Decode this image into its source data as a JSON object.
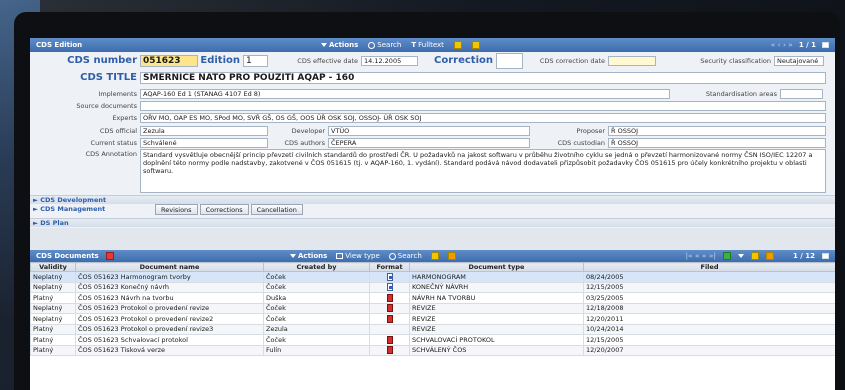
{
  "window": {
    "title": "CDS Edition",
    "actions": "Actions",
    "search": "Search",
    "fulltext": "Fulltext",
    "pager": "1 / 1"
  },
  "form": {
    "cds_number_label": "CDS number",
    "cds_number": "051623",
    "edition_label": "Edition",
    "edition": "1",
    "effective_label": "CDS effective date",
    "effective": "14.12.2005",
    "correction_label": "Correction",
    "correction": "",
    "correction_date_label": "CDS correction date",
    "correction_date": "",
    "security_label": "Security classification",
    "security": "Neutajované",
    "title_label": "CDS TITLE",
    "title": "SMĚRNICE NATO PRO POUŽITÍ AQAP - 160",
    "implements_label": "Implements",
    "implements": "AQAP-160 Ed 1 (STANAG 4107 Ed 8)",
    "std_areas_label": "Standardisation areas",
    "std_areas": "",
    "source_label": "Source documents",
    "source": "",
    "experts_label": "Experts",
    "experts": "OŘV MO, OAP ES MO, SPod MO, SVŘ GŠ, OS GŠ, OOS ÚŘ OSK SOJ, OSSOJ- ÚŘ OSK SOJ",
    "official_label": "CDS official",
    "official": "Zezula",
    "developer_label": "Developer",
    "developer": "VTÚO",
    "proposer_label": "Proposer",
    "proposer": "Ř OSSOJ",
    "status_label": "Current status",
    "status": "Schválené",
    "authors_label": "CDS authors",
    "authors": "ČEPERA",
    "custodian_label": "CDS custodian",
    "custodian": "Ř OSSOJ",
    "annotation_label": "CDS Annotation",
    "annotation": "Standard vysvětluje obecnější princip převzetí civilních standardů do prostředí ČR. U požadavků na jakost softwaru v průběhu životního cyklu se jedná o převzetí harmonizované normy ČSN ISO/IEC 12207 a doplnění této normy podle nadstavby, zakotvené v ČOS 051615 (tj. v AQAP-160, 1. vydání). Standard podává návod dodavateli přizpůsobit požadavky ČOS 051615 pro účely konkrétního projektu v oblasti softwaru."
  },
  "sections": {
    "development": "► CDS Development",
    "management": "► CDS Management",
    "plan": "► DS Plan"
  },
  "buttons": {
    "revisions": "Revisions",
    "corrections": "Corrections",
    "cancellation": "Cancellation"
  },
  "docs": {
    "title": "CDS Documents",
    "actions": "Actions",
    "view_type": "View type",
    "search": "Search",
    "pager": "1 / 12",
    "columns": [
      "Validity",
      "Document name",
      "Created by",
      "Format",
      "Document type",
      "Filed"
    ],
    "rows": [
      {
        "validity": "Neplatný",
        "name": "ČOS 051623 Harmonogram tvorby",
        "created": "Čoček",
        "format": "doc",
        "type": "HARMONOGRAM",
        "filed": "08/24/2005"
      },
      {
        "validity": "Neplatný",
        "name": "ČOS 051623 Konečný návrh",
        "created": "Čoček",
        "format": "doc",
        "type": "KONEČNÝ NÁVRH",
        "filed": "12/15/2005"
      },
      {
        "validity": "Platný",
        "name": "ČOS 051623 Návrh na tvorbu",
        "created": "Duška",
        "format": "pdf",
        "type": "NÁVRH NA TVORBU",
        "filed": "03/25/2005"
      },
      {
        "validity": "Neplatný",
        "name": "ČOS 051623 Protokol o provedení revize",
        "created": "Čoček",
        "format": "pdf",
        "type": "REVIZE",
        "filed": "12/18/2008"
      },
      {
        "validity": "Neplatný",
        "name": "ČOS 051623 Protokol o provedení revize2",
        "created": "Čoček",
        "format": "pdf",
        "type": "REVIZE",
        "filed": "12/20/2011"
      },
      {
        "validity": "Platný",
        "name": "ČOS 051623 Protokol o provedení revize3",
        "created": "Zezula",
        "format": "",
        "type": "REVIZE",
        "filed": "10/24/2014"
      },
      {
        "validity": "Platný",
        "name": "ČOS 051623 Schvalovací protokol",
        "created": "Čoček",
        "format": "pdf",
        "type": "SCHVALOVACÍ PROTOKOL",
        "filed": "12/15/2005"
      },
      {
        "validity": "Platný",
        "name": "ČOS 051623 Tisková verze",
        "created": "Fulín",
        "format": "pdf",
        "type": "SCHVÁLENÝ ČOS",
        "filed": "12/20/2007"
      }
    ]
  }
}
